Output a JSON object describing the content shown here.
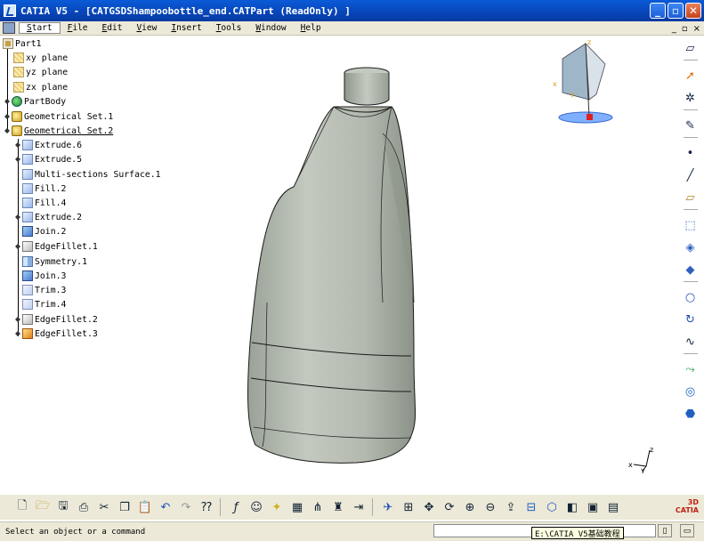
{
  "window": {
    "title": "CATIA V5 - [CATGSDShampoobottle_end.CATPart (ReadOnly) ]",
    "minimize": "_",
    "maximize": "▫",
    "close": "✕"
  },
  "menubar": {
    "items": [
      "Start",
      "File",
      "Edit",
      "View",
      "Insert",
      "Tools",
      "Window",
      "Help"
    ],
    "accel": [
      "S",
      "F",
      "E",
      "V",
      "I",
      "T",
      "W",
      "H"
    ],
    "rest": [
      "tart",
      "ile",
      "dit",
      "iew",
      "nsert",
      "ools",
      "indow",
      "elp"
    ],
    "selected": "Start",
    "doc_controls": [
      "_",
      "▫",
      "×"
    ]
  },
  "tree": {
    "root": "Part1",
    "planes": [
      "xy plane",
      "yz plane",
      "zx plane"
    ],
    "body": "PartBody",
    "gset1": "Geometrical Set.1",
    "gset2": "Geometrical Set.2",
    "children": [
      {
        "label": "Extrude.6",
        "icon": "surface-icon",
        "expandable": true
      },
      {
        "label": "Extrude.5",
        "icon": "surface-icon",
        "expandable": true
      },
      {
        "label": "Multi-sections Surface.1",
        "icon": "surface-icon",
        "expandable": false
      },
      {
        "label": "Fill.2",
        "icon": "surface-icon",
        "expandable": false
      },
      {
        "label": "Fill.4",
        "icon": "surface-icon",
        "expandable": false
      },
      {
        "label": "Extrude.2",
        "icon": "surface-icon",
        "expandable": true
      },
      {
        "label": "Join.2",
        "icon": "join-icon",
        "expandable": false
      },
      {
        "label": "EdgeFillet.1",
        "icon": "fillet-icon",
        "expandable": true
      },
      {
        "label": "Symmetry.1",
        "icon": "symmetry-icon",
        "expandable": false
      },
      {
        "label": "Join.3",
        "icon": "join-icon",
        "expandable": false
      },
      {
        "label": "Trim.3",
        "icon": "trim-icon",
        "expandable": false
      },
      {
        "label": "Trim.4",
        "icon": "trim-icon",
        "expandable": false
      },
      {
        "label": "EdgeFillet.2",
        "icon": "fillet-icon",
        "expandable": true
      },
      {
        "label": "EdgeFillet.3",
        "icon": "fillet-active-icon",
        "expandable": true
      }
    ]
  },
  "compass": {
    "x": "x",
    "y": "y",
    "z": "z"
  },
  "axis": {
    "x": "x",
    "y": "y",
    "z": "z"
  },
  "right_toolbar": [
    "sketcher-icon",
    "select-arrow-icon",
    "snap-icon",
    "sketch-icon",
    "point-icon",
    "line-icon",
    "plane-icon",
    "extrude-surface-icon",
    "revolve-icon",
    "sweep-icon",
    "circle-icon",
    "spiral-icon",
    "spline-icon",
    "blend-icon",
    "multi-section-icon",
    "fill-icon"
  ],
  "bottom_toolbar": [
    "new-icon",
    "open-icon",
    "save-icon",
    "print-icon",
    "cut-icon",
    "copy-icon",
    "paste-icon",
    "undo-icon",
    "redo-icon",
    "whats-this-icon",
    "formula-icon",
    "knowledge-icon",
    "light-icon",
    "table-icon",
    "tree-icon",
    "catalog-icon",
    "measure-icon",
    "fly-icon",
    "fit-all-icon",
    "pan-icon",
    "rotate-icon",
    "zoom-in-icon",
    "zoom-out-icon",
    "normal-view-icon",
    "multiview-icon",
    "iso-view-icon",
    "shading-icon",
    "hide-show-icon",
    "swap-visible-icon"
  ],
  "brand": {
    "line1": "3D",
    "line2": "CATIA"
  },
  "status": {
    "message": "Select an object or a command",
    "tooltip": "E:\\CATIA V5基础教程"
  },
  "colors": {
    "titlebar": "#0845b8",
    "bottle_surface": "#b9c0b4",
    "bottle_shadow": "#8d9589",
    "edges": "#1a1a1a",
    "compass_plate": "#7fb0ff"
  }
}
